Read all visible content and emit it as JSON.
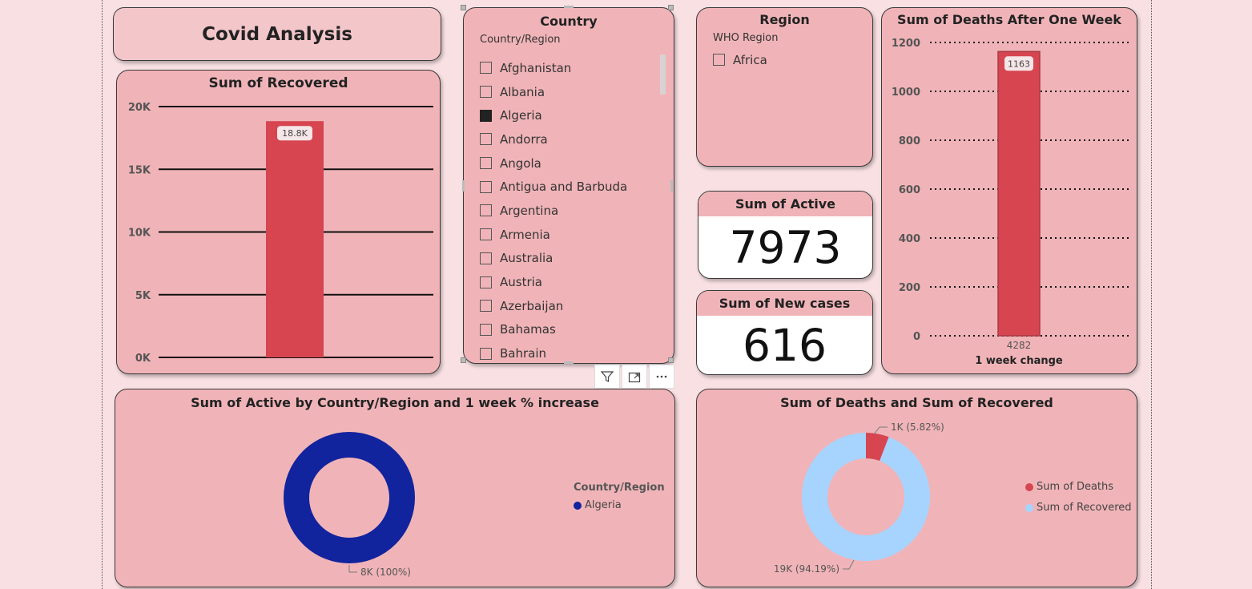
{
  "page": {
    "title": "Covid Analysis"
  },
  "country_slicer": {
    "title": "Country",
    "field": "Country/Region",
    "items": [
      {
        "label": "Afghanistan",
        "checked": false
      },
      {
        "label": "Albania",
        "checked": false
      },
      {
        "label": "Algeria",
        "checked": true
      },
      {
        "label": "Andorra",
        "checked": false
      },
      {
        "label": "Angola",
        "checked": false
      },
      {
        "label": "Antigua and Barbuda",
        "checked": false
      },
      {
        "label": "Argentina",
        "checked": false
      },
      {
        "label": "Armenia",
        "checked": false
      },
      {
        "label": "Australia",
        "checked": false
      },
      {
        "label": "Austria",
        "checked": false
      },
      {
        "label": "Azerbaijan",
        "checked": false
      },
      {
        "label": "Bahamas",
        "checked": false
      },
      {
        "label": "Bahrain",
        "checked": false
      }
    ],
    "toolbar": {
      "filter_icon": "filter-icon",
      "focus_icon": "focus-mode-icon",
      "more_icon": "more-options-icon"
    }
  },
  "region_slicer": {
    "title": "Region",
    "field": "WHO Region",
    "items": [
      {
        "label": "Africa",
        "checked": false
      }
    ]
  },
  "kpis": {
    "active": {
      "label": "Sum of Active",
      "value": "7973"
    },
    "new_cases": {
      "label": "Sum of New cases",
      "value": "616"
    }
  },
  "chart_data": [
    {
      "id": "sum-of-recovered",
      "type": "bar",
      "title": "Sum of Recovered",
      "categories": [
        ""
      ],
      "values": [
        18837
      ],
      "data_labels": [
        "18.8K"
      ],
      "yticks": [
        "0K",
        "5K",
        "10K",
        "15K",
        "20K"
      ],
      "ylim": [
        0,
        20000
      ],
      "color": "#d64550"
    },
    {
      "id": "sum-of-deaths-after-one-week",
      "type": "bar",
      "title": "Sum of Deaths After One Week",
      "categories": [
        "4282"
      ],
      "values": [
        1163
      ],
      "data_labels": [
        "1163"
      ],
      "xlabel": "1 week change",
      "yticks": [
        "0",
        "200",
        "400",
        "600",
        "800",
        "1000",
        "1200"
      ],
      "ylim": [
        0,
        1200
      ],
      "color": "#d64550"
    },
    {
      "id": "active-by-country-week-increase",
      "type": "pie",
      "title": "Sum of Active by Country/Region and 1 week % increase",
      "legend_title": "Country/Region",
      "labels": [
        "Algeria"
      ],
      "values": [
        7973
      ],
      "data_labels": [
        "8K (100%)"
      ],
      "colors": [
        "#12239e"
      ]
    },
    {
      "id": "deaths-and-recovered",
      "type": "pie",
      "title": "Sum of Deaths and Sum of Recovered",
      "labels": [
        "Sum of Deaths",
        "Sum of Recovered"
      ],
      "values": [
        1163,
        18837
      ],
      "data_labels": [
        "1K (5.82%)",
        "19K (94.19%)"
      ],
      "colors": [
        "#d64550",
        "#a7d3ff"
      ]
    }
  ]
}
